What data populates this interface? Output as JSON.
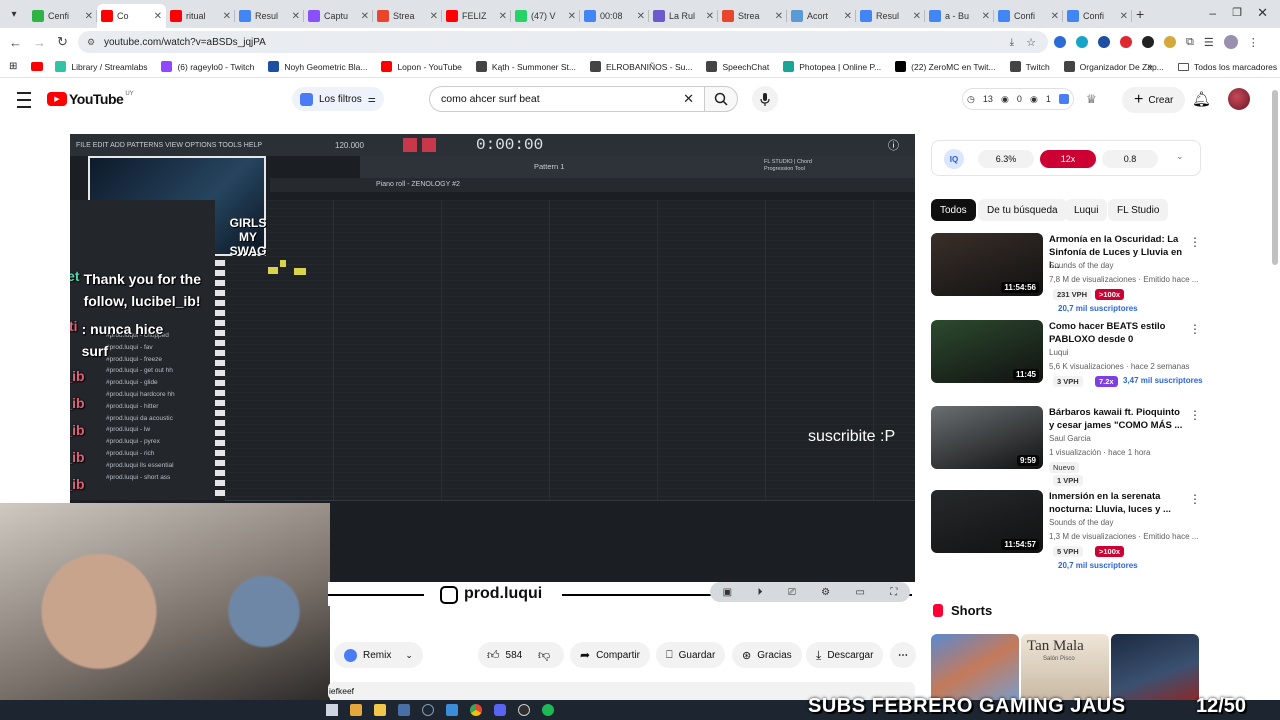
{
  "browser": {
    "tabs": [
      {
        "label": "Cenfi",
        "color": "#2fb344"
      },
      {
        "label": "Co",
        "color": "#ff0000",
        "active": true
      },
      {
        "label": "ritual",
        "color": "#ff0000"
      },
      {
        "label": "Resul",
        "color": "#4285f4"
      },
      {
        "label": "Captu",
        "color": "#8a4fff"
      },
      {
        "label": "Strea",
        "color": "#e8452c"
      },
      {
        "label": "FELIZ",
        "color": "#ff0000"
      },
      {
        "label": "(47) V",
        "color": "#25d366"
      },
      {
        "label": "00:08",
        "color": "#4285f4"
      },
      {
        "label": "La Rul",
        "color": "#6a5acd"
      },
      {
        "label": "Strea",
        "color": "#e8452c"
      },
      {
        "label": "Acort",
        "color": "#5b9bd5"
      },
      {
        "label": "Resul",
        "color": "#4285f4"
      },
      {
        "label": "a - Bu",
        "color": "#4285f4"
      },
      {
        "label": "Confi",
        "color": "#4285f4"
      },
      {
        "label": "Confi",
        "color": "#4285f4"
      }
    ],
    "url": "youtube.com/watch?v=aBSDs_jqjPA",
    "bookmarks": [
      {
        "label": "Library / Streamlabs",
        "color": "#31c3a2"
      },
      {
        "label": "(6) rageylo0 - Twitch",
        "color": "#9146ff"
      },
      {
        "label": "Noyh Geometric Bla...",
        "color": "#1e4fa3"
      },
      {
        "label": "Lopon - YouTube",
        "color": "#ff0000"
      },
      {
        "label": "Kąth - Summoner St...",
        "color": "#444444"
      },
      {
        "label": "ELROBANIÑOS - Su...",
        "color": "#444444"
      },
      {
        "label": "SpeechChat",
        "color": "#444444"
      },
      {
        "label": "Photopea | Online P...",
        "color": "#18a497"
      },
      {
        "label": "(22) ZeroMC en Twit...",
        "color": "#000000"
      },
      {
        "label": "Twitch",
        "color": "#444444"
      },
      {
        "label": "Organizador De Zap...",
        "color": "#444444"
      }
    ],
    "all_bookmarks": "Todos los marcadores"
  },
  "youtube": {
    "logo_text": "YouTube",
    "country": "UY",
    "filters_label": "Los filtros",
    "search_value": "como ahcer surf beat",
    "stats": {
      "a": "13",
      "b": "0",
      "c": "1"
    },
    "create_label": "Crear"
  },
  "video": {
    "toolbar_menu": "FILE EDIT ADD PATTERNS VIEW OPTIONS TOOLS HELP",
    "bpm": "120.000",
    "time": "0:00:00",
    "pattern": "Pattern 1",
    "piano_roll_title": "Piano roll - ZENOLOGY #2",
    "fl_label": "FL STUDIO | Chord Progression Tool",
    "overlay_sticker": "GIRLS MY SWAG",
    "subscribe_text": "suscribite :P",
    "instagram": "prod.luqui",
    "chat": [
      {
        "user": "@Kickiet",
        "msg": "Thank you for the follow, lucibel_ib!"
      },
      {
        "user": "lorenzeti",
        "msg": ": nunca hice surf"
      },
      {
        "user": "lucibel_ib",
        "msg": ""
      },
      {
        "user": "lucibel_ib",
        "msg": ""
      },
      {
        "user": "lucibel_ib",
        "msg": ""
      },
      {
        "user": "lucibel_ib",
        "msg": ""
      },
      {
        "user": "lucibel_ib",
        "msg": ""
      }
    ],
    "browser_files": [
      "#prod.luqui - chopped",
      "#prod.luqui - fav",
      "#prod.luqui - freeze",
      "#prod.luqui - get out hh",
      "#prod.luqui - glide",
      "#prod.luqui hardcore hh",
      "#prod.luqui - hitter",
      "#prod.luqui da acoustic",
      "#prod.luqui - lw",
      "#prod.luqui - pyrex",
      "#prod.luqui - rich",
      "#prod.luqui lls essential",
      "#prod.luqui - short ass"
    ]
  },
  "actions": {
    "remix": "Remix",
    "likes": "584",
    "share": "Compartir",
    "save": "Guardar",
    "thanks": "Gracias",
    "download": "Descargar",
    "comment_preview": "iefkeef"
  },
  "sidebar": {
    "ext_values": [
      "6.3%",
      "12x",
      "0.8"
    ],
    "chips": [
      "Todos",
      "De tu búsqueda",
      "Luqui",
      "FL Studio"
    ],
    "recommendations": [
      {
        "title": "Armonía en la Oscuridad: La Sinfonía de Luces y Lluvia en l...",
        "channel": "Sounds of the day",
        "meta": "7,8 M de visualizaciones · Emitido hace ...",
        "duration": "11:54:56",
        "vph": "231 VPH",
        "mult": ">100x",
        "subs": "20,7 mil suscriptores",
        "thumb": "#3a2f2a"
      },
      {
        "title": "Como hacer BEATS estilo PABLOXO desde 0",
        "channel": "Luqui",
        "meta": "5,6 K visualizaciones · hace 2 semanas",
        "duration": "11:45",
        "vph": "3 VPH",
        "mult": "7.2x",
        "subs": "3,47 mil suscriptores",
        "thumb": "#2c4a2e"
      },
      {
        "title": "Bárbaros kawaii ft. Pioquinto y cesar james \"COMO MÁS ...",
        "channel": "Saul Garcia",
        "meta": "1 visualización · hace 1 hora",
        "duration": "9:59",
        "vph": "1 VPH",
        "mult": "",
        "subs": "",
        "badge": "Nuevo",
        "thumb": "#6a6f72"
      },
      {
        "title": "Inmersión en la serenata nocturna: Lluvia, luces y ...",
        "channel": "Sounds of the day",
        "meta": "1,3 M de visualizaciones · Emitido hace ...",
        "duration": "11:54:57",
        "vph": "5 VPH",
        "mult": ">100x",
        "subs": "20,7 mil suscriptores",
        "thumb": "#26292b"
      }
    ],
    "shorts_label": "Shorts",
    "shorts": [
      "",
      "Tan Mala",
      ""
    ]
  },
  "stream_overlay": {
    "banner": "SUBS FEBRERO GAMING JAUS",
    "counter": "12/50",
    "shorts_sub": "Salón Pisco"
  },
  "colors": {
    "yt_red": "#ff0000",
    "accent_iq": "#4a7cf5",
    "mult_red": "#cc0033",
    "mult_purple": "#7b3fe4"
  }
}
